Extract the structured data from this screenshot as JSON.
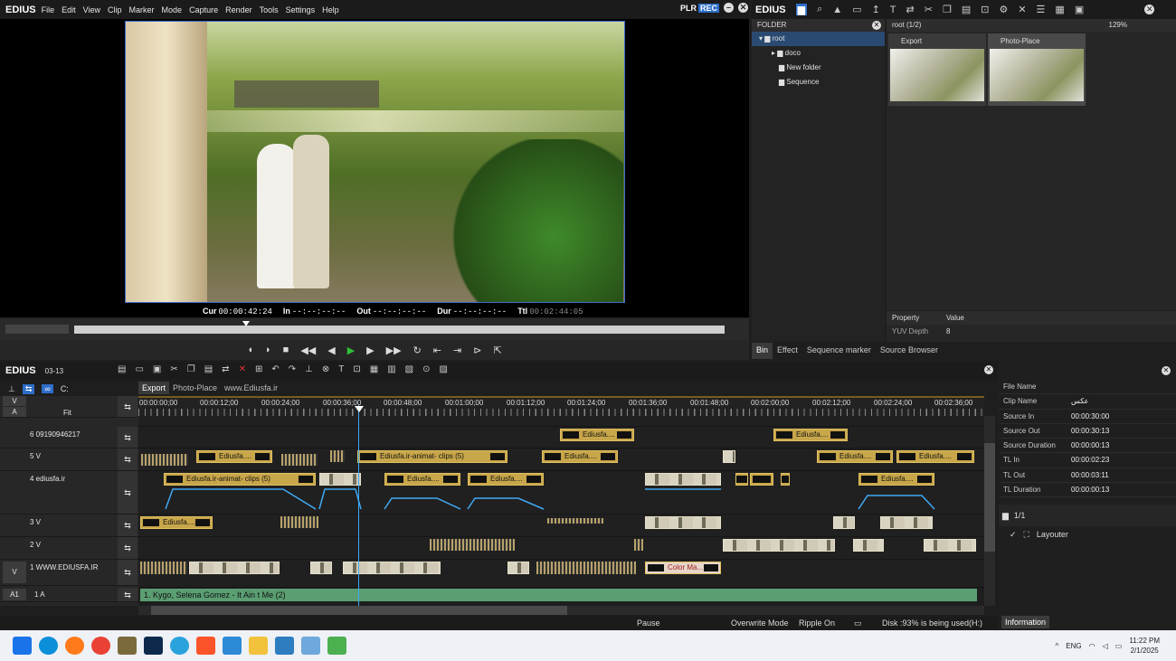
{
  "app": {
    "name": "EDIUS"
  },
  "menu": [
    "File",
    "Edit",
    "View",
    "Clip",
    "Marker",
    "Mode",
    "Capture",
    "Render",
    "Tools",
    "Settings",
    "Help"
  ],
  "plr": "PLR",
  "rec": "REC",
  "timecodes": {
    "cur_label": "Cur",
    "cur": "00:00:42:24",
    "in_label": "In",
    "in": "--:--:--:--",
    "out_label": "Out",
    "out": "--:--:--:--",
    "dur_label": "Dur",
    "dur": "--:--:--:--",
    "ttl_label": "Ttl",
    "ttl": "00:02:44:05"
  },
  "bin": {
    "logo": "EDIUS",
    "folder_header": "FOLDER",
    "tree": [
      "root",
      "doco",
      "New folder",
      "Sequence"
    ],
    "path": "root (1/2)",
    "zoom": "129%",
    "thumbs": [
      "Export",
      "Photo-Place"
    ],
    "property_header": "Property",
    "value_header": "Value",
    "prop_name": "YUV Depth",
    "prop_value": "8",
    "tabs": [
      "Bin",
      "Effect",
      "Sequence marker",
      "Source Browser"
    ]
  },
  "timeline": {
    "logo": "EDIUS",
    "seq": "03-13",
    "tabs": [
      "Export",
      "Photo-Place",
      "www.Ediusfa.ir"
    ],
    "ruler": [
      "00:00:00;00",
      "00:00:12;00",
      "00:00:24;00",
      "00:00:36;00",
      "00:00:48;00",
      "00:01:00;00",
      "00:01:12;00",
      "00:01:24;00",
      "00:01:36;00",
      "00:01:48;00",
      "00:02:00;00",
      "00:02:12;00",
      "00:02:24;00",
      "00:02:36;00"
    ],
    "fit": "Fit",
    "tracks": [
      "6 09190946217",
      "5 V",
      "4 ediusfa.ir",
      "3 V",
      "2 V",
      "1 WWW.EDIUSFA.IR",
      "1 A"
    ],
    "track_tags": [
      "V",
      "A",
      "V",
      "A1"
    ],
    "clip_ediusfa": "Ediusfa....",
    "clip_animat": "Ediusfa.ir-animat- clips (5)",
    "clip_color": "Color Ma...",
    "audio_clip": "1. Kygo, Selena Gomez - It Ain t Me (2)"
  },
  "info": {
    "rows": [
      {
        "k": "File Name",
        "v": ""
      },
      {
        "k": "Clip Name",
        "v": "عکس"
      },
      {
        "k": "Source In",
        "v": "00:00:30:00"
      },
      {
        "k": "Source Out",
        "v": "00:00:30:13"
      },
      {
        "k": "Source Duration",
        "v": "00:00:00:13"
      },
      {
        "k": "TL In",
        "v": "00:00:02:23"
      },
      {
        "k": "TL Out",
        "v": "00:00:03:11"
      },
      {
        "k": "TL Duration",
        "v": "00:00:00:13"
      }
    ],
    "layer_count": "1/1",
    "layouter": "Layouter",
    "tab": "Information"
  },
  "status": {
    "state": "Pause",
    "mode": "Overwrite Mode",
    "ripple": "Ripple On",
    "disk": "Disk :93% is being used(H:)"
  },
  "tray": {
    "lang": "ENG",
    "time": "11:22 PM",
    "date": "2/1/2025"
  },
  "colors": {
    "accent": "#2d6ec9",
    "clip": "#c8a64a",
    "audio": "#5a9e72",
    "playhead": "#3fa9f5"
  }
}
